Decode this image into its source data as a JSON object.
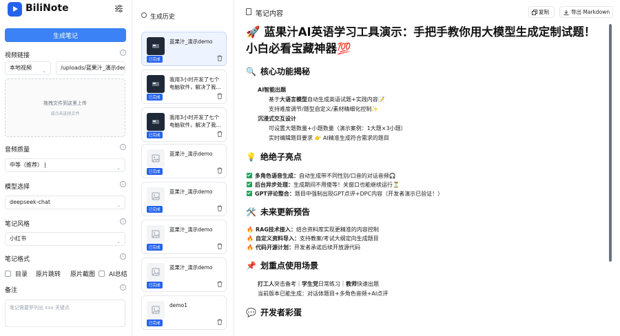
{
  "app": {
    "name": "BiliNote"
  },
  "left": {
    "generate_button": "生成笔记",
    "video_link_label": "视频链接",
    "source_select": "本地视频",
    "link_value": "/uploads/蓝果汁_演示dem",
    "upload_hint": "拖拽文件到这里上传",
    "upload_sub": "或点击选择文件",
    "quality_label": "音频质量",
    "quality_value": "中等（推荐）",
    "model_label": "模型选择",
    "model_value": "deepseek-chat",
    "style_label": "笔记风格",
    "style_value": "小红书",
    "format_label": "笔记格式",
    "format_options": [
      "目录",
      "原片跳转",
      "原片截图",
      "AI总结"
    ],
    "remark_label": "备注",
    "remark_placeholder": "笔记需要罗列出 xxx 关键点"
  },
  "history": {
    "title": "生成历史",
    "items": [
      {
        "title": "蓝果汁_演示demo",
        "badge": "已完成",
        "thumb": "video",
        "active": true
      },
      {
        "title": "我用3小时开发了七个电脑软件，解决了我...",
        "badge": "已完成",
        "thumb": "video",
        "active": false
      },
      {
        "title": "我用3小时开发了七个电脑软件，解决了我...",
        "badge": "已完成",
        "thumb": "video",
        "active": false
      },
      {
        "title": "蓝果汁_演示demo",
        "badge": "已完成",
        "thumb": "image-placeholder",
        "active": false
      },
      {
        "title": "蓝果汁_演示demo",
        "badge": "已完成",
        "thumb": "image-placeholder",
        "active": false
      },
      {
        "title": "蓝果汁_演示demo",
        "badge": "已完成",
        "thumb": "image-placeholder",
        "active": false
      },
      {
        "title": "蓝果汁_演示demo",
        "badge": "已完成",
        "thumb": "image-placeholder",
        "active": false
      },
      {
        "title": "demo1",
        "badge": "已完成",
        "thumb": "image-placeholder",
        "active": false
      }
    ]
  },
  "note": {
    "header": "笔记内容",
    "copy_button": "复制",
    "export_button": "导出 Markdown",
    "title": "🚀 蓝果汁AI英语学习工具演示：手把手教你用大模型生成定制试题！小白必看宝藏神器💯",
    "s1": {
      "emoji": "🔍",
      "heading": "核心功能揭秘",
      "a": "AI智能出题",
      "a1_pre": "基于",
      "a1_bold": "大语言模型",
      "a1_post": "自动生成英语试题+实践内容📝",
      "a2": "支持难度调节/题型自定义/素材精细化控制✨",
      "b": "沉浸式交互设计",
      "b1": "可设置大题数量+小题数量（演示案例：1大题×3小题）",
      "b2": "实时编辑题目要求 👉 AI精准生成符合需求的题目"
    },
    "s2": {
      "emoji": "💡",
      "heading": "绝绝子亮点",
      "l1_bold": "多角色语音生成：",
      "l1": "自动生成带不同性别/口音的对话音频🎧",
      "l2_bold": "后台异步处理：",
      "l2": "生成期间不用傻等！关窗口也能继续运行⏳",
      "l3_bold": "GPT评论整合：",
      "l3": "题目中强制出现GPT点评+DPC内容（开发者演示已验证！）"
    },
    "s3": {
      "emoji": "🛠️",
      "heading": "未来更新预告",
      "l1_bold": "RAG技术接入：",
      "l1": "结合资料库实现更精准的内容控制",
      "l2_bold": "自定义资料导入：",
      "l2": "支持教案/考试大纲定向生成题目",
      "l3_bold": "代码开源计划：",
      "l3": "开发者承诺后续开放源代码"
    },
    "s4": {
      "emoji": "📌",
      "heading": "划重点使用场景",
      "p1_b1": "打工人",
      "p1_t1": "突击备考｜",
      "p1_b2": "学生党",
      "p1_t2": "日常练习｜",
      "p1_b3": "教师",
      "p1_t3": "快速出题",
      "p2": "当前版本已能生成：对话体题目+多角色音频+AI点评"
    },
    "s5": {
      "emoji": "💬",
      "heading": "开发者彩蛋"
    }
  }
}
